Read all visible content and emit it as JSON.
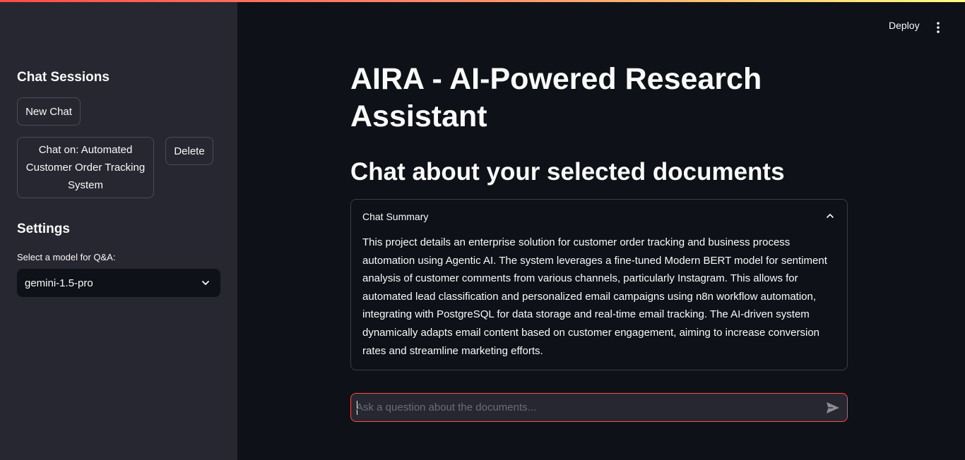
{
  "sidebar": {
    "sessions_heading": "Chat Sessions",
    "new_chat_label": "New Chat",
    "session_item_label": "Chat on: Automated Customer Order Tracking System",
    "delete_label": "Delete",
    "settings_heading": "Settings",
    "model_label": "Select a model for Q&A:",
    "model_value": "gemini-1.5-pro"
  },
  "header": {
    "deploy_label": "Deploy",
    "menu_icon": "kebab-menu-icon"
  },
  "main": {
    "title": "AIRA - AI-Powered Research Assistant",
    "subtitle": "Chat about your selected documents",
    "summary_title": "Chat Summary",
    "summary_text": "This project details an enterprise solution for customer order tracking and business process automation using Agentic AI. The system leverages a fine-tuned Modern BERT model for sentiment analysis of customer comments from various channels, particularly Instagram. This allows for automated lead classification and personalized email campaigns using n8n workflow automation, integrating with PostgreSQL for data storage and real-time email tracking. The AI-driven system dynamically adapts email content based on customer engagement, aiming to increase conversion rates and streamline marketing efforts.",
    "chat_placeholder": "Ask a question about the documents..."
  },
  "colors": {
    "accent": "#ff4b4b",
    "sidebar_bg": "#262730",
    "main_bg": "#0e1117"
  }
}
